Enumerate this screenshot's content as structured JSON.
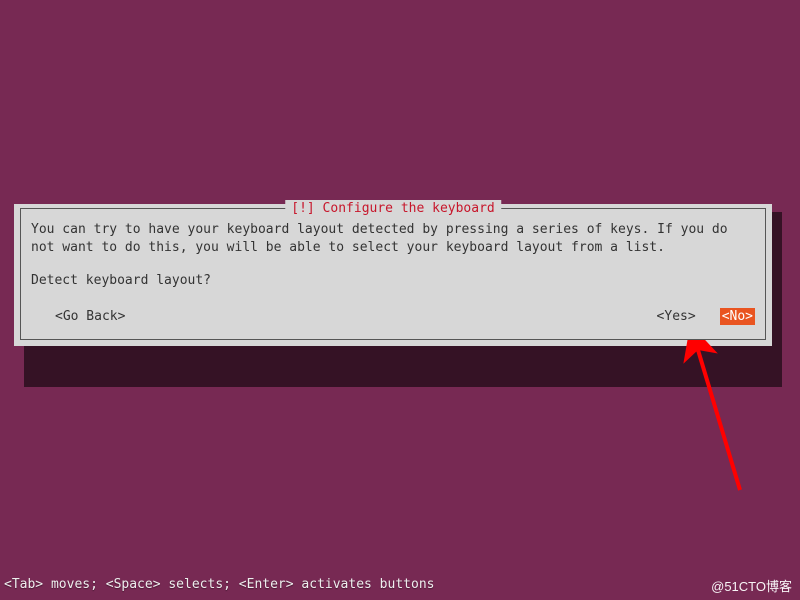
{
  "dialog": {
    "title": "[!] Configure the keyboard",
    "body": "You can try to have your keyboard layout detected by pressing a series of keys. If you do not want to do this, you will be able to select your keyboard layout from a list.",
    "prompt": "Detect keyboard layout?",
    "buttons": {
      "go_back": "<Go Back>",
      "yes": "<Yes>",
      "no": "<No>"
    }
  },
  "hint_bar": "<Tab> moves; <Space> selects; <Enter> activates buttons",
  "watermark": "@51CTO博客",
  "colors": {
    "background": "#772953",
    "dialog_bg": "#d7d7d7",
    "title": "#c7162b",
    "selected_bg": "#e95420",
    "selected_fg": "#ffffff",
    "arrow": "#ff0000"
  }
}
